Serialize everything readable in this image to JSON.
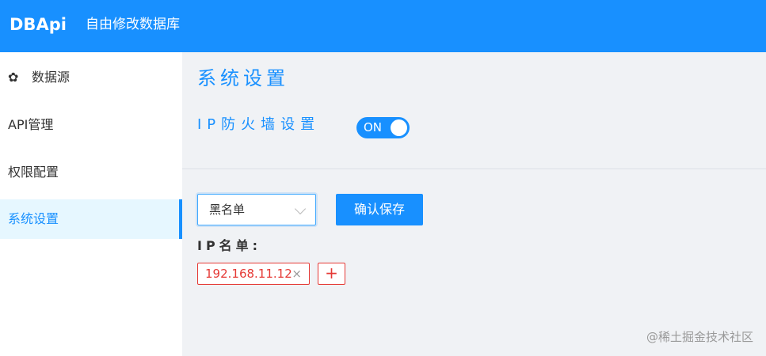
{
  "header": {
    "brand": "DBApi",
    "link": "自由修改数据库"
  },
  "sidebar": {
    "items": [
      {
        "label": "数据源",
        "icon": "gear-icon"
      },
      {
        "label": "API管理"
      },
      {
        "label": "权限配置"
      },
      {
        "label": "系统设置",
        "active": true
      }
    ]
  },
  "main": {
    "title": "系统设置",
    "firewall": {
      "label": "IP防火墙设置",
      "toggle_text": "ON",
      "enabled": true
    },
    "mode_select": {
      "value": "黑名单"
    },
    "save_label": "确认保存",
    "ip_list_label": "IP名单:",
    "ip_tags": [
      {
        "ip": "192.168.11.12",
        "close": "×"
      }
    ],
    "add_label": "+"
  },
  "watermark": "@稀土掘金技术社区",
  "colors": {
    "primary": "#1890ff",
    "danger": "#e53935"
  }
}
